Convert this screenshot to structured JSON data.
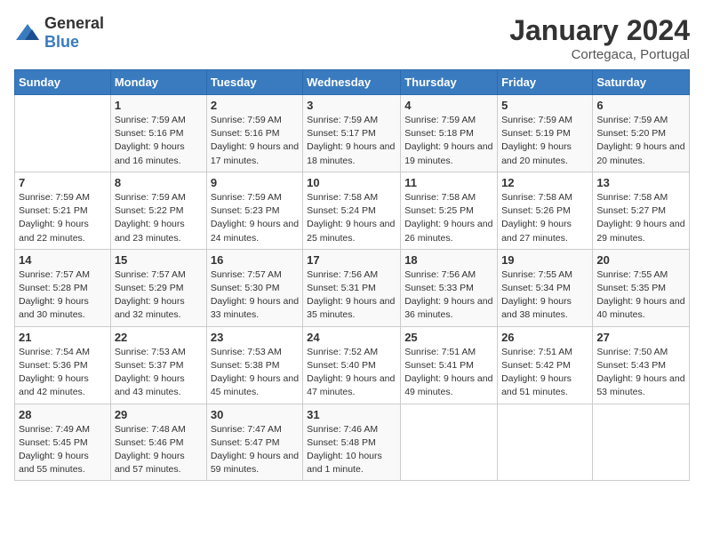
{
  "logo": {
    "text_general": "General",
    "text_blue": "Blue"
  },
  "title": "January 2024",
  "location": "Cortegaca, Portugal",
  "days_header": [
    "Sunday",
    "Monday",
    "Tuesday",
    "Wednesday",
    "Thursday",
    "Friday",
    "Saturday"
  ],
  "weeks": [
    [
      {
        "day": "",
        "sunrise": "",
        "sunset": "",
        "daylight": ""
      },
      {
        "day": "1",
        "sunrise": "Sunrise: 7:59 AM",
        "sunset": "Sunset: 5:16 PM",
        "daylight": "Daylight: 9 hours and 16 minutes."
      },
      {
        "day": "2",
        "sunrise": "Sunrise: 7:59 AM",
        "sunset": "Sunset: 5:16 PM",
        "daylight": "Daylight: 9 hours and 17 minutes."
      },
      {
        "day": "3",
        "sunrise": "Sunrise: 7:59 AM",
        "sunset": "Sunset: 5:17 PM",
        "daylight": "Daylight: 9 hours and 18 minutes."
      },
      {
        "day": "4",
        "sunrise": "Sunrise: 7:59 AM",
        "sunset": "Sunset: 5:18 PM",
        "daylight": "Daylight: 9 hours and 19 minutes."
      },
      {
        "day": "5",
        "sunrise": "Sunrise: 7:59 AM",
        "sunset": "Sunset: 5:19 PM",
        "daylight": "Daylight: 9 hours and 20 minutes."
      },
      {
        "day": "6",
        "sunrise": "Sunrise: 7:59 AM",
        "sunset": "Sunset: 5:20 PM",
        "daylight": "Daylight: 9 hours and 20 minutes."
      }
    ],
    [
      {
        "day": "7",
        "sunrise": "Sunrise: 7:59 AM",
        "sunset": "Sunset: 5:21 PM",
        "daylight": "Daylight: 9 hours and 22 minutes."
      },
      {
        "day": "8",
        "sunrise": "Sunrise: 7:59 AM",
        "sunset": "Sunset: 5:22 PM",
        "daylight": "Daylight: 9 hours and 23 minutes."
      },
      {
        "day": "9",
        "sunrise": "Sunrise: 7:59 AM",
        "sunset": "Sunset: 5:23 PM",
        "daylight": "Daylight: 9 hours and 24 minutes."
      },
      {
        "day": "10",
        "sunrise": "Sunrise: 7:58 AM",
        "sunset": "Sunset: 5:24 PM",
        "daylight": "Daylight: 9 hours and 25 minutes."
      },
      {
        "day": "11",
        "sunrise": "Sunrise: 7:58 AM",
        "sunset": "Sunset: 5:25 PM",
        "daylight": "Daylight: 9 hours and 26 minutes."
      },
      {
        "day": "12",
        "sunrise": "Sunrise: 7:58 AM",
        "sunset": "Sunset: 5:26 PM",
        "daylight": "Daylight: 9 hours and 27 minutes."
      },
      {
        "day": "13",
        "sunrise": "Sunrise: 7:58 AM",
        "sunset": "Sunset: 5:27 PM",
        "daylight": "Daylight: 9 hours and 29 minutes."
      }
    ],
    [
      {
        "day": "14",
        "sunrise": "Sunrise: 7:57 AM",
        "sunset": "Sunset: 5:28 PM",
        "daylight": "Daylight: 9 hours and 30 minutes."
      },
      {
        "day": "15",
        "sunrise": "Sunrise: 7:57 AM",
        "sunset": "Sunset: 5:29 PM",
        "daylight": "Daylight: 9 hours and 32 minutes."
      },
      {
        "day": "16",
        "sunrise": "Sunrise: 7:57 AM",
        "sunset": "Sunset: 5:30 PM",
        "daylight": "Daylight: 9 hours and 33 minutes."
      },
      {
        "day": "17",
        "sunrise": "Sunrise: 7:56 AM",
        "sunset": "Sunset: 5:31 PM",
        "daylight": "Daylight: 9 hours and 35 minutes."
      },
      {
        "day": "18",
        "sunrise": "Sunrise: 7:56 AM",
        "sunset": "Sunset: 5:33 PM",
        "daylight": "Daylight: 9 hours and 36 minutes."
      },
      {
        "day": "19",
        "sunrise": "Sunrise: 7:55 AM",
        "sunset": "Sunset: 5:34 PM",
        "daylight": "Daylight: 9 hours and 38 minutes."
      },
      {
        "day": "20",
        "sunrise": "Sunrise: 7:55 AM",
        "sunset": "Sunset: 5:35 PM",
        "daylight": "Daylight: 9 hours and 40 minutes."
      }
    ],
    [
      {
        "day": "21",
        "sunrise": "Sunrise: 7:54 AM",
        "sunset": "Sunset: 5:36 PM",
        "daylight": "Daylight: 9 hours and 42 minutes."
      },
      {
        "day": "22",
        "sunrise": "Sunrise: 7:53 AM",
        "sunset": "Sunset: 5:37 PM",
        "daylight": "Daylight: 9 hours and 43 minutes."
      },
      {
        "day": "23",
        "sunrise": "Sunrise: 7:53 AM",
        "sunset": "Sunset: 5:38 PM",
        "daylight": "Daylight: 9 hours and 45 minutes."
      },
      {
        "day": "24",
        "sunrise": "Sunrise: 7:52 AM",
        "sunset": "Sunset: 5:40 PM",
        "daylight": "Daylight: 9 hours and 47 minutes."
      },
      {
        "day": "25",
        "sunrise": "Sunrise: 7:51 AM",
        "sunset": "Sunset: 5:41 PM",
        "daylight": "Daylight: 9 hours and 49 minutes."
      },
      {
        "day": "26",
        "sunrise": "Sunrise: 7:51 AM",
        "sunset": "Sunset: 5:42 PM",
        "daylight": "Daylight: 9 hours and 51 minutes."
      },
      {
        "day": "27",
        "sunrise": "Sunrise: 7:50 AM",
        "sunset": "Sunset: 5:43 PM",
        "daylight": "Daylight: 9 hours and 53 minutes."
      }
    ],
    [
      {
        "day": "28",
        "sunrise": "Sunrise: 7:49 AM",
        "sunset": "Sunset: 5:45 PM",
        "daylight": "Daylight: 9 hours and 55 minutes."
      },
      {
        "day": "29",
        "sunrise": "Sunrise: 7:48 AM",
        "sunset": "Sunset: 5:46 PM",
        "daylight": "Daylight: 9 hours and 57 minutes."
      },
      {
        "day": "30",
        "sunrise": "Sunrise: 7:47 AM",
        "sunset": "Sunset: 5:47 PM",
        "daylight": "Daylight: 9 hours and 59 minutes."
      },
      {
        "day": "31",
        "sunrise": "Sunrise: 7:46 AM",
        "sunset": "Sunset: 5:48 PM",
        "daylight": "Daylight: 10 hours and 1 minute."
      },
      {
        "day": "",
        "sunrise": "",
        "sunset": "",
        "daylight": ""
      },
      {
        "day": "",
        "sunrise": "",
        "sunset": "",
        "daylight": ""
      },
      {
        "day": "",
        "sunrise": "",
        "sunset": "",
        "daylight": ""
      }
    ]
  ]
}
